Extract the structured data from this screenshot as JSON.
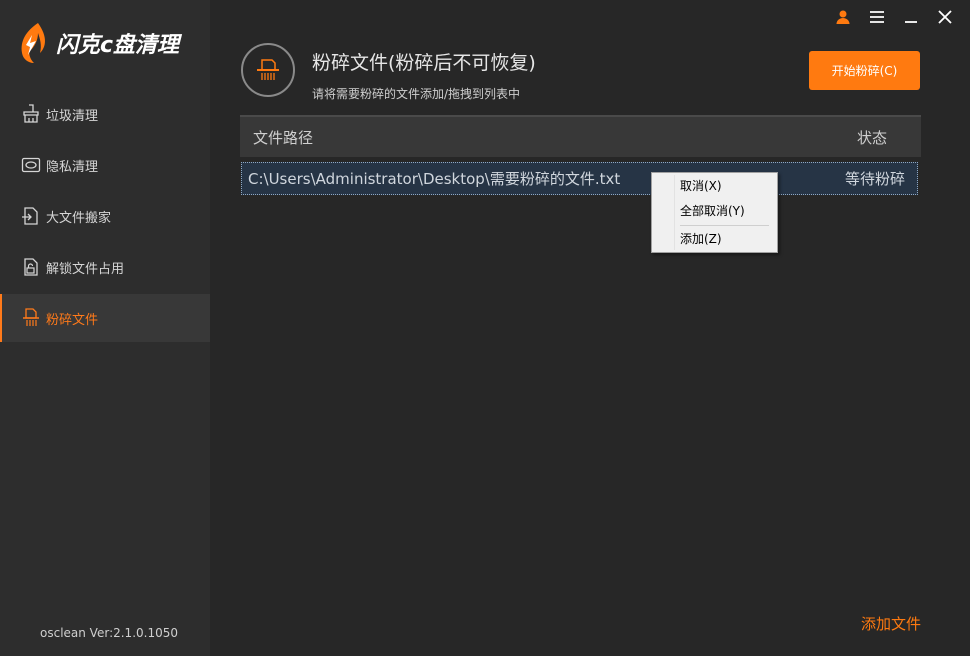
{
  "app": {
    "logo_text": "闪克c盘清理",
    "version": "osclean Ver:2.1.0.1050",
    "accent": "#ff7a10"
  },
  "window_controls": [
    {
      "name": "user-icon"
    },
    {
      "name": "menu-icon"
    },
    {
      "name": "minimize-icon"
    },
    {
      "name": "close-icon"
    }
  ],
  "sidebar": {
    "items": [
      {
        "label": "垃圾清理",
        "icon": "broom-icon",
        "active": false
      },
      {
        "label": "隐私清理",
        "icon": "privacy-icon",
        "active": false
      },
      {
        "label": "大文件搬家",
        "icon": "move-file-icon",
        "active": false
      },
      {
        "label": "解锁文件占用",
        "icon": "unlock-file-icon",
        "active": false
      },
      {
        "label": "粉碎文件",
        "icon": "shredder-icon",
        "active": true
      }
    ]
  },
  "header": {
    "title": "粉碎文件(粉碎后不可恢复)",
    "subtitle": "请将需要粉碎的文件添加/拖拽到列表中",
    "start_button": "开始粉碎(C)"
  },
  "table": {
    "columns": [
      "文件路径",
      "状态"
    ],
    "rows": [
      {
        "path": "C:\\Users\\Administrator\\Desktop\\需要粉碎的文件.txt",
        "status": "等待粉碎"
      }
    ]
  },
  "context_menu": {
    "items": [
      "取消(X)",
      "全部取消(Y)",
      "添加(Z)"
    ]
  },
  "footer": {
    "add_file": "添加文件"
  }
}
